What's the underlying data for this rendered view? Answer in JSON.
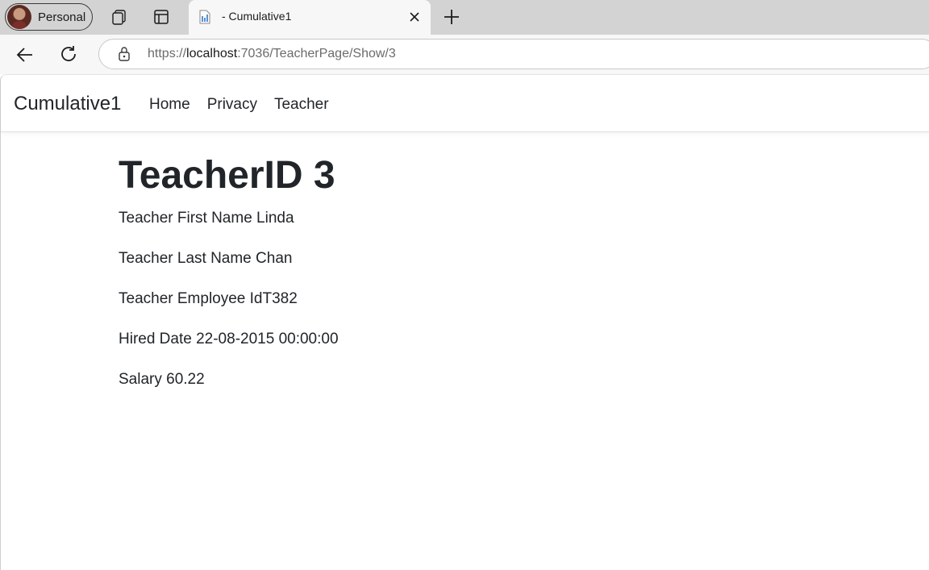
{
  "browser": {
    "profile_label": "Personal",
    "tab_title": "- Cumulative1",
    "url_scheme": "https://",
    "url_host": "localhost",
    "url_path": ":7036/TeacherPage/Show/3"
  },
  "navbar": {
    "brand": "Cumulative1",
    "links": [
      "Home",
      "Privacy",
      "Teacher"
    ]
  },
  "main": {
    "heading": "TeacherID 3",
    "fields": [
      "Teacher First Name Linda",
      "Teacher Last Name Chan",
      "Teacher Employee IdT382",
      "Hired Date 22-08-2015 00:00:00",
      "Salary 60.22"
    ]
  },
  "icons": {
    "profile": "avatar",
    "workspaces": "workspaces-icon",
    "tab_actions": "tab-actions-icon",
    "tab_favicon": "page-favicon-icon",
    "tab_close": "close-icon",
    "new_tab": "plus-icon",
    "back": "back-arrow-icon",
    "refresh": "refresh-icon",
    "lock": "lock-icon"
  }
}
